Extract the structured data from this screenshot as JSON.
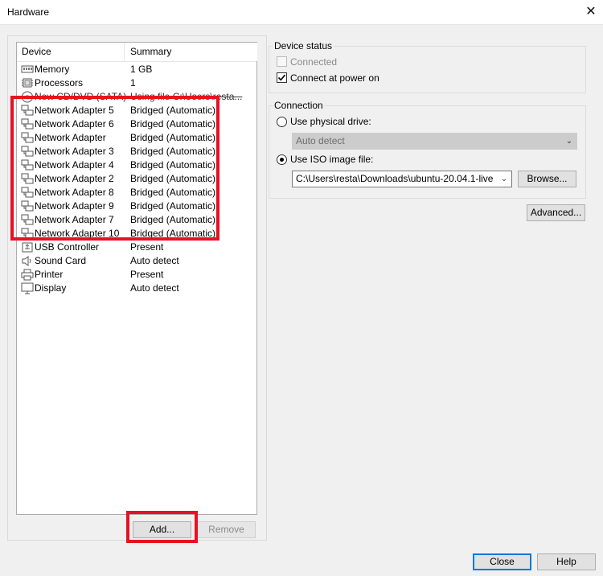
{
  "window": {
    "title": "Hardware",
    "close_glyph": "✕"
  },
  "device_list": {
    "headers": {
      "device": "Device",
      "summary": "Summary"
    },
    "rows": [
      {
        "icon": "memory-icon",
        "name": "Memory",
        "summary": "1 GB"
      },
      {
        "icon": "processor-icon",
        "name": "Processors",
        "summary": "1"
      },
      {
        "icon": "cd-dvd-icon",
        "name": "New CD/DVD (SATA)",
        "summary": "Using file C:\\Users\\resta..."
      },
      {
        "icon": "network-adapter-icon",
        "name": "Network Adapter 5",
        "summary": "Bridged (Automatic)"
      },
      {
        "icon": "network-adapter-icon",
        "name": "Network Adapter 6",
        "summary": "Bridged (Automatic)"
      },
      {
        "icon": "network-adapter-icon",
        "name": "Network Adapter",
        "summary": "Bridged (Automatic)"
      },
      {
        "icon": "network-adapter-icon",
        "name": "Network Adapter 3",
        "summary": "Bridged (Automatic)"
      },
      {
        "icon": "network-adapter-icon",
        "name": "Network Adapter 4",
        "summary": "Bridged (Automatic)"
      },
      {
        "icon": "network-adapter-icon",
        "name": "Network Adapter 2",
        "summary": "Bridged (Automatic)"
      },
      {
        "icon": "network-adapter-icon",
        "name": "Network Adapter 8",
        "summary": "Bridged (Automatic)"
      },
      {
        "icon": "network-adapter-icon",
        "name": "Network Adapter 9",
        "summary": "Bridged (Automatic)"
      },
      {
        "icon": "network-adapter-icon",
        "name": "Network Adapter 7",
        "summary": "Bridged (Automatic)"
      },
      {
        "icon": "network-adapter-icon",
        "name": "Network Adapter 10",
        "summary": "Bridged (Automatic)"
      },
      {
        "icon": "usb-icon",
        "name": "USB Controller",
        "summary": "Present"
      },
      {
        "icon": "sound-card-icon",
        "name": "Sound Card",
        "summary": "Auto detect"
      },
      {
        "icon": "printer-icon",
        "name": "Printer",
        "summary": "Present"
      },
      {
        "icon": "display-icon",
        "name": "Display",
        "summary": "Auto detect"
      }
    ],
    "add_label": "Add...",
    "remove_label": "Remove"
  },
  "device_status": {
    "label": "Device status",
    "connected_label": "Connected",
    "connected_checked": false,
    "connect_power_label": "Connect at power on",
    "connect_power_checked": true
  },
  "connection": {
    "label": "Connection",
    "physical_label": "Use physical drive:",
    "physical_value": "Auto detect",
    "iso_label": "Use ISO image file:",
    "iso_value": "C:\\Users\\resta\\Downloads\\ubuntu-20.04.1-live",
    "browse_label": "Browse..."
  },
  "advanced_label": "Advanced...",
  "footer": {
    "close_label": "Close",
    "help_label": "Help"
  },
  "colors": {
    "annotation": "#e81123",
    "focus": "#0078d7"
  }
}
